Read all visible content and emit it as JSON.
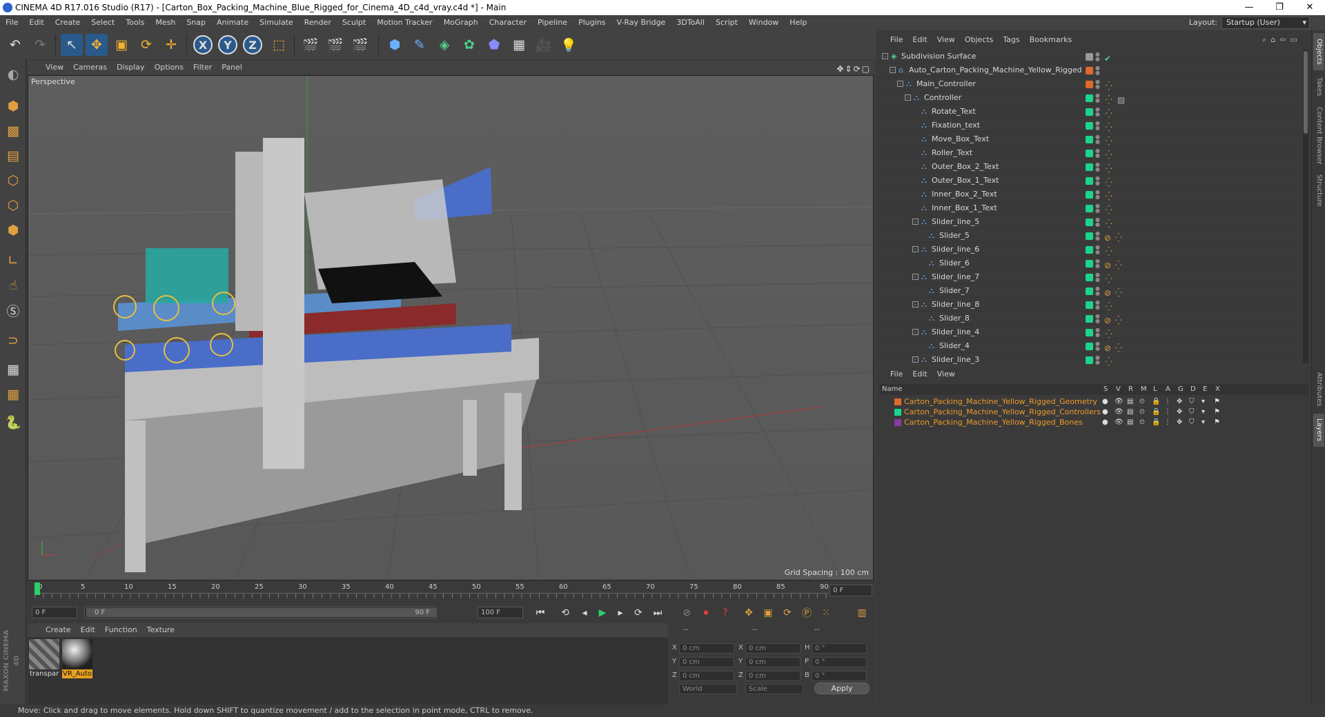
{
  "window": {
    "title": "CINEMA 4D R17.016 Studio (R17) - [Carton_Box_Packing_Machine_Blue_Rigged_for_Cinema_4D_c4d_vray.c4d *] - Main",
    "min": "—",
    "restore": "❐",
    "close": "✕"
  },
  "menubar": {
    "items": [
      "File",
      "Edit",
      "Create",
      "Select",
      "Tools",
      "Mesh",
      "Snap",
      "Animate",
      "Simulate",
      "Render",
      "Sculpt",
      "Motion Tracker",
      "MoGraph",
      "Character",
      "Pipeline",
      "Plugins",
      "V-Ray Bridge",
      "3DToAll",
      "Script",
      "Window",
      "Help"
    ],
    "layout_label": "Layout:",
    "layout_value": "Startup (User)"
  },
  "toolbar": {
    "undo": "↶",
    "redo": "↷",
    "select": "↖",
    "move": "✥",
    "scale": "▣",
    "rotate": "⟳",
    "last": "✛",
    "x": "X",
    "y": "Y",
    "z": "Z",
    "coord": "⬚",
    "render_view": "🎬",
    "render_pv": "🎬",
    "render_settings": "🎬",
    "cube": "⬢",
    "pen": "✎",
    "subdiv": "◈",
    "array": "✿",
    "deform": "⬟",
    "floor": "▦",
    "camera": "🎥",
    "light": "💡"
  },
  "viewport": {
    "menu": [
      "View",
      "Cameras",
      "Display",
      "Options",
      "Filter",
      "Panel"
    ],
    "label": "Perspective",
    "grid_spacing": "Grid Spacing : 100 cm"
  },
  "timeline": {
    "ticks": [
      "0",
      "5",
      "10",
      "15",
      "20",
      "25",
      "30",
      "35",
      "40",
      "45",
      "50",
      "55",
      "60",
      "65",
      "70",
      "75",
      "80",
      "85",
      "90"
    ],
    "current_frame": "0 F"
  },
  "transport": {
    "start": "0 F",
    "range_start": "0 F",
    "range_end": "90 F",
    "end": "100 F"
  },
  "material_manager": {
    "menu": [
      "Create",
      "Edit",
      "Function",
      "Texture"
    ],
    "materials": [
      "transpar",
      "VR_Auto"
    ]
  },
  "coordinates": {
    "header": [
      "--",
      "--",
      "--"
    ],
    "rows": [
      {
        "a": "X",
        "av": "0 cm",
        "b": "X",
        "bv": "0 cm",
        "c": "H",
        "cv": "0 °"
      },
      {
        "a": "Y",
        "av": "0 cm",
        "b": "Y",
        "bv": "0 cm",
        "c": "P",
        "cv": "0 °"
      },
      {
        "a": "Z",
        "av": "0 cm",
        "b": "Z",
        "bv": "0 cm",
        "c": "B",
        "cv": "0 °"
      }
    ],
    "mode1": "World",
    "mode2": "Scale",
    "apply": "Apply"
  },
  "object_manager": {
    "menu": [
      "File",
      "Edit",
      "View",
      "Objects",
      "Tags",
      "Bookmarks"
    ],
    "objects": [
      {
        "label": "Subdivision Surface",
        "indent": 0,
        "toggle": "-",
        "color": "#9a9a9a",
        "tag": "check"
      },
      {
        "label": "Auto_Carton_Packing_Machine_Yellow_Rigged",
        "indent": 1,
        "toggle": "-",
        "color": "#e06a2a",
        "tag": ""
      },
      {
        "label": "Main_Controller",
        "indent": 2,
        "toggle": "-",
        "color": "#e06a2a",
        "tag": "joint"
      },
      {
        "label": "Controller",
        "indent": 3,
        "toggle": "-",
        "color": "#1bd68a",
        "tag": "joint2"
      },
      {
        "label": "Rotate_Text",
        "indent": 4,
        "toggle": "",
        "color": "#1bd68a",
        "tag": "joint"
      },
      {
        "label": "Fixation_text",
        "indent": 4,
        "toggle": "",
        "color": "#1bd68a",
        "tag": "joint"
      },
      {
        "label": "Move_Box_Text",
        "indent": 4,
        "toggle": "",
        "color": "#1bd68a",
        "tag": "joint"
      },
      {
        "label": "Roller_Text",
        "indent": 4,
        "toggle": "",
        "color": "#1bd68a",
        "tag": "joint"
      },
      {
        "label": "Outer_Box_2_Text",
        "indent": 4,
        "toggle": "",
        "color": "#1bd68a",
        "tag": "joint"
      },
      {
        "label": "Outer_Box_1_Text",
        "indent": 4,
        "toggle": "",
        "color": "#1bd68a",
        "tag": "joint"
      },
      {
        "label": "Inner_Box_2_Text",
        "indent": 4,
        "toggle": "",
        "color": "#1bd68a",
        "tag": "joint"
      },
      {
        "label": "Inner_Box_1_Text",
        "indent": 4,
        "toggle": "",
        "color": "#1bd68a",
        "tag": "joint"
      },
      {
        "label": "Slider_line_5",
        "indent": 4,
        "toggle": "-",
        "color": "#1bd68a",
        "tag": "joint"
      },
      {
        "label": "Slider_5",
        "indent": 5,
        "toggle": "",
        "color": "#1bd68a",
        "tag": "protect"
      },
      {
        "label": "Slider_line_6",
        "indent": 4,
        "toggle": "-",
        "color": "#1bd68a",
        "tag": "joint"
      },
      {
        "label": "Slider_6",
        "indent": 5,
        "toggle": "",
        "color": "#1bd68a",
        "tag": "protect"
      },
      {
        "label": "Slider_line_7",
        "indent": 4,
        "toggle": "-",
        "color": "#1bd68a",
        "tag": "joint"
      },
      {
        "label": "Slider_7",
        "indent": 5,
        "toggle": "",
        "color": "#1bd68a",
        "tag": "protect"
      },
      {
        "label": "Slider_line_8",
        "indent": 4,
        "toggle": "-",
        "color": "#1bd68a",
        "tag": "joint"
      },
      {
        "label": "Slider_8",
        "indent": 5,
        "toggle": "",
        "color": "#1bd68a",
        "tag": "protect"
      },
      {
        "label": "Slider_line_4",
        "indent": 4,
        "toggle": "-",
        "color": "#1bd68a",
        "tag": "joint"
      },
      {
        "label": "Slider_4",
        "indent": 5,
        "toggle": "",
        "color": "#1bd68a",
        "tag": "protect"
      },
      {
        "label": "Slider_line_3",
        "indent": 4,
        "toggle": "-",
        "color": "#1bd68a",
        "tag": "joint"
      }
    ]
  },
  "layer_manager": {
    "menu": [
      "File",
      "Edit",
      "View"
    ],
    "columns": [
      "Name",
      "S",
      "V",
      "R",
      "M",
      "L",
      "A",
      "G",
      "D",
      "E",
      "X"
    ],
    "layers": [
      {
        "name": "Carton_Packing_Machine_Yellow_Rigged_Geometry",
        "color": "#e06a2a"
      },
      {
        "name": "Carton_Packing_Machine_Yellow_Rigged_Controllers",
        "color": "#1bd68a"
      },
      {
        "name": "Carton_Packing_Machine_Yellow_Rigged_Bones",
        "color": "#8a3aa0"
      }
    ]
  },
  "right_tabs": [
    "Objects",
    "Takes",
    "Content Browser",
    "Structure",
    "Attributes",
    "Layers"
  ],
  "branding": "MAXON CINEMA 4D",
  "status": "Move: Click and drag to move elements. Hold down SHIFT to quantize movement / add to the selection in point mode, CTRL to remove."
}
